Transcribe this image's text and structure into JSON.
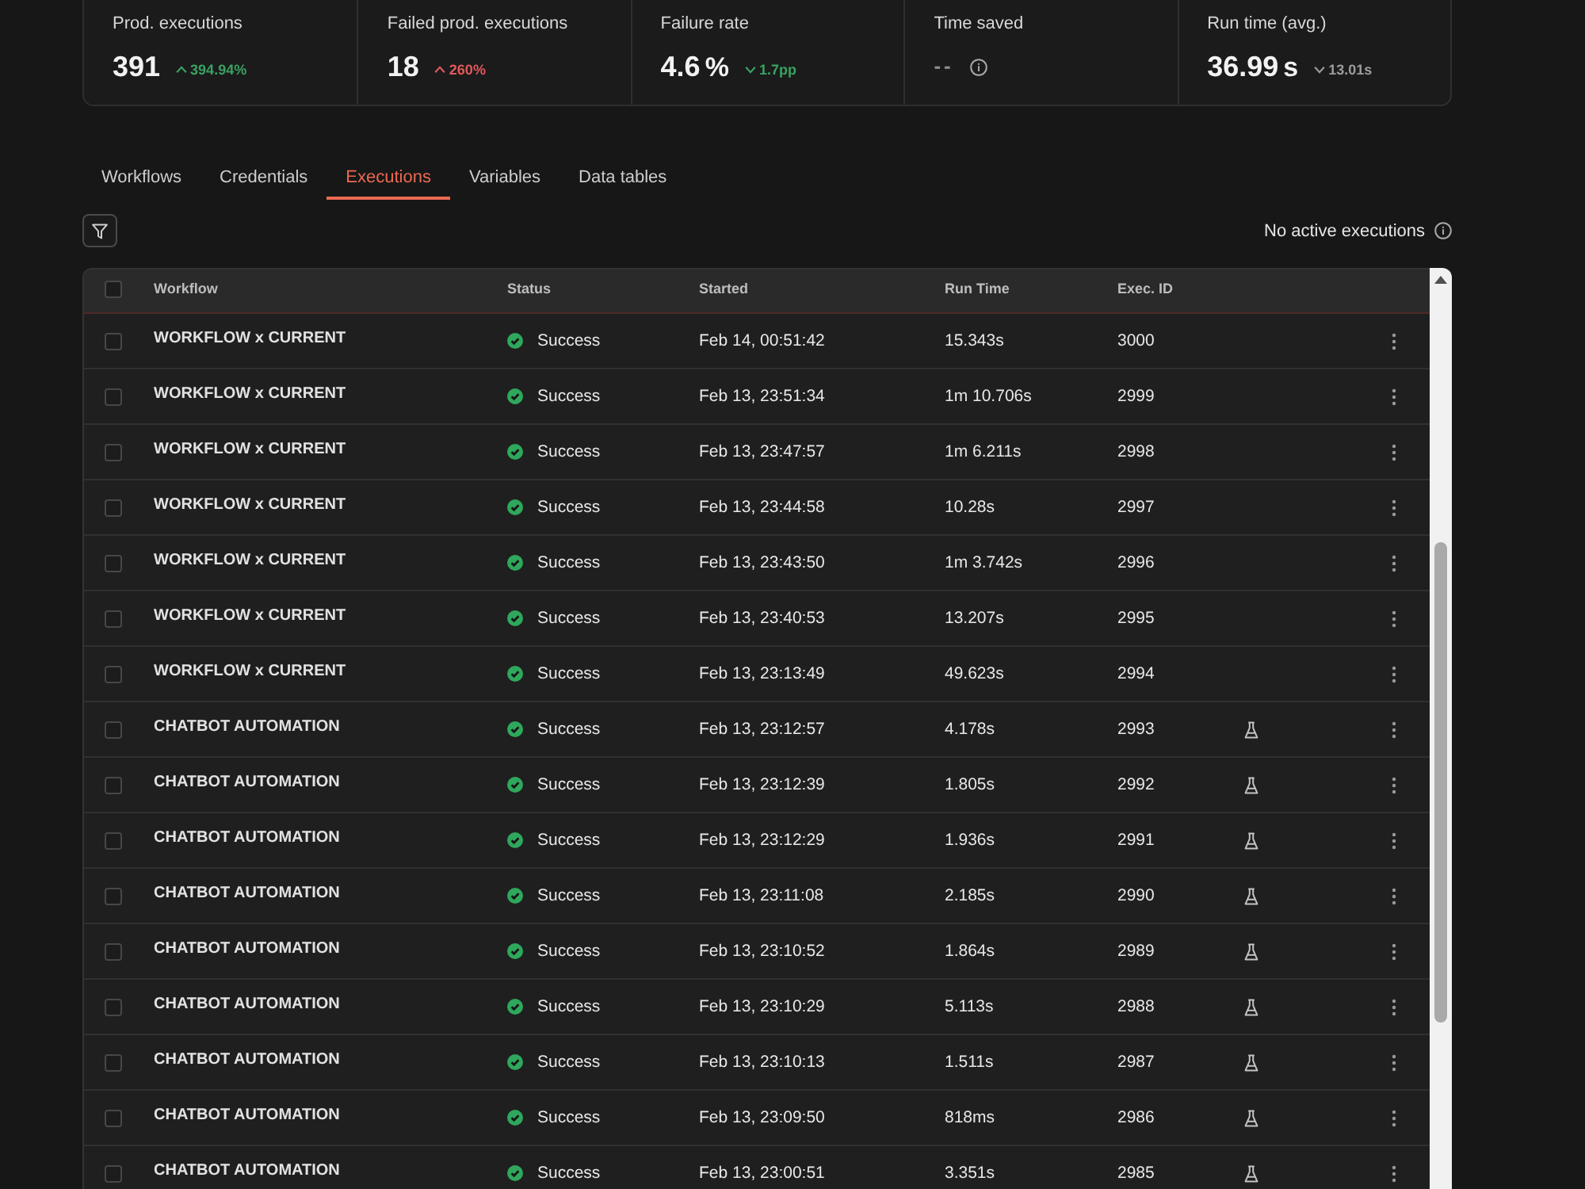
{
  "stats": [
    {
      "label": "Prod. executions",
      "kind": "metric",
      "value": "391",
      "trend": {
        "text": "394.94%",
        "up": true,
        "color": "#3aa362"
      }
    },
    {
      "label": "Failed prod. executions",
      "kind": "metric",
      "value": "18",
      "trend": {
        "text": "260%",
        "up": true,
        "color": "#e0595b"
      }
    },
    {
      "label": "Failure rate",
      "kind": "metric",
      "value": "4.6",
      "unit": "%",
      "trend": {
        "text": "1.7pp",
        "up": false,
        "color": "#3aa362"
      }
    },
    {
      "label": "Time saved",
      "kind": "info",
      "value": "--"
    },
    {
      "label": "Run time (avg.)",
      "kind": "metric",
      "value": "36.99",
      "unit": "s",
      "trend": {
        "text": "13.01s",
        "up": false,
        "color": "#9c9c9c"
      }
    }
  ],
  "tabs": [
    {
      "label": "Workflows",
      "selected": false
    },
    {
      "label": "Credentials",
      "selected": false
    },
    {
      "label": "Executions",
      "selected": true
    },
    {
      "label": "Variables",
      "selected": false
    },
    {
      "label": "Data tables",
      "selected": false
    }
  ],
  "toolbar": {
    "active_status": "No active executions"
  },
  "table": {
    "header_checkbox": {
      "checked": false
    },
    "columns": [
      "Workflow",
      "Status",
      "Started",
      "Run Time",
      "Exec. ID"
    ],
    "rows": [
      {
        "checked": false,
        "workflow": "WORKFLOW x CURRENT",
        "status": {
          "label": "Success",
          "kind": "success"
        },
        "started": "Feb 14, 00:51:42",
        "run_time": "15.343s",
        "exec_id": "3000",
        "test_run": false
      },
      {
        "checked": false,
        "workflow": "WORKFLOW x CURRENT",
        "status": {
          "label": "Success",
          "kind": "success"
        },
        "started": "Feb 13, 23:51:34",
        "run_time": "1m 10.706s",
        "exec_id": "2999",
        "test_run": false
      },
      {
        "checked": false,
        "workflow": "WORKFLOW x CURRENT",
        "status": {
          "label": "Success",
          "kind": "success"
        },
        "started": "Feb 13, 23:47:57",
        "run_time": "1m 6.211s",
        "exec_id": "2998",
        "test_run": false
      },
      {
        "checked": false,
        "workflow": "WORKFLOW x CURRENT",
        "status": {
          "label": "Success",
          "kind": "success"
        },
        "started": "Feb 13, 23:44:58",
        "run_time": "10.28s",
        "exec_id": "2997",
        "test_run": false
      },
      {
        "checked": false,
        "workflow": "WORKFLOW x CURRENT",
        "status": {
          "label": "Success",
          "kind": "success"
        },
        "started": "Feb 13, 23:43:50",
        "run_time": "1m 3.742s",
        "exec_id": "2996",
        "test_run": false
      },
      {
        "checked": false,
        "workflow": "WORKFLOW x CURRENT",
        "status": {
          "label": "Success",
          "kind": "success"
        },
        "started": "Feb 13, 23:40:53",
        "run_time": "13.207s",
        "exec_id": "2995",
        "test_run": false
      },
      {
        "checked": false,
        "workflow": "WORKFLOW x CURRENT",
        "status": {
          "label": "Success",
          "kind": "success"
        },
        "started": "Feb 13, 23:13:49",
        "run_time": "49.623s",
        "exec_id": "2994",
        "test_run": false
      },
      {
        "checked": false,
        "workflow": "CHATBOT AUTOMATION",
        "status": {
          "label": "Success",
          "kind": "success"
        },
        "started": "Feb 13, 23:12:57",
        "run_time": "4.178s",
        "exec_id": "2993",
        "test_run": true
      },
      {
        "checked": false,
        "workflow": "CHATBOT AUTOMATION",
        "status": {
          "label": "Success",
          "kind": "success"
        },
        "started": "Feb 13, 23:12:39",
        "run_time": "1.805s",
        "exec_id": "2992",
        "test_run": true
      },
      {
        "checked": false,
        "workflow": "CHATBOT AUTOMATION",
        "status": {
          "label": "Success",
          "kind": "success"
        },
        "started": "Feb 13, 23:12:29",
        "run_time": "1.936s",
        "exec_id": "2991",
        "test_run": true
      },
      {
        "checked": false,
        "workflow": "CHATBOT AUTOMATION",
        "status": {
          "label": "Success",
          "kind": "success"
        },
        "started": "Feb 13, 23:11:08",
        "run_time": "2.185s",
        "exec_id": "2990",
        "test_run": true
      },
      {
        "checked": false,
        "workflow": "CHATBOT AUTOMATION",
        "status": {
          "label": "Success",
          "kind": "success"
        },
        "started": "Feb 13, 23:10:52",
        "run_time": "1.864s",
        "exec_id": "2989",
        "test_run": true
      },
      {
        "checked": false,
        "workflow": "CHATBOT AUTOMATION",
        "status": {
          "label": "Success",
          "kind": "success"
        },
        "started": "Feb 13, 23:10:29",
        "run_time": "5.113s",
        "exec_id": "2988",
        "test_run": true
      },
      {
        "checked": false,
        "workflow": "CHATBOT AUTOMATION",
        "status": {
          "label": "Success",
          "kind": "success"
        },
        "started": "Feb 13, 23:10:13",
        "run_time": "1.511s",
        "exec_id": "2987",
        "test_run": true
      },
      {
        "checked": false,
        "workflow": "CHATBOT AUTOMATION",
        "status": {
          "label": "Success",
          "kind": "success"
        },
        "started": "Feb 13, 23:09:50",
        "run_time": "818ms",
        "exec_id": "2986",
        "test_run": true
      },
      {
        "checked": false,
        "workflow": "CHATBOT AUTOMATION",
        "status": {
          "label": "Success",
          "kind": "success"
        },
        "started": "Feb 13, 23:00:51",
        "run_time": "3.351s",
        "exec_id": "2985",
        "test_run": true
      }
    ]
  }
}
